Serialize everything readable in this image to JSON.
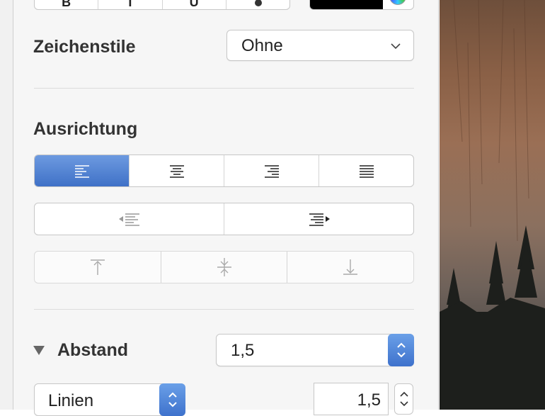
{
  "zeichenstile": {
    "label": "Zeichenstile",
    "value": "Ohne"
  },
  "ausrichtung": {
    "label": "Ausrichtung",
    "alignment_buttons": [
      "align-left",
      "align-center",
      "align-right",
      "justify"
    ],
    "selected": "align-left",
    "indent_buttons": [
      "decrease-indent",
      "increase-indent"
    ],
    "vertical_buttons": [
      "align-top",
      "align-middle",
      "align-bottom"
    ]
  },
  "abstand": {
    "label": "Abstand",
    "value": "1,5"
  },
  "linien": {
    "label": "Linien",
    "value": "1,5"
  },
  "colors": {
    "accent": "#4a7fd6",
    "panel_bg": "#f6f6f6",
    "text": "#333333"
  }
}
